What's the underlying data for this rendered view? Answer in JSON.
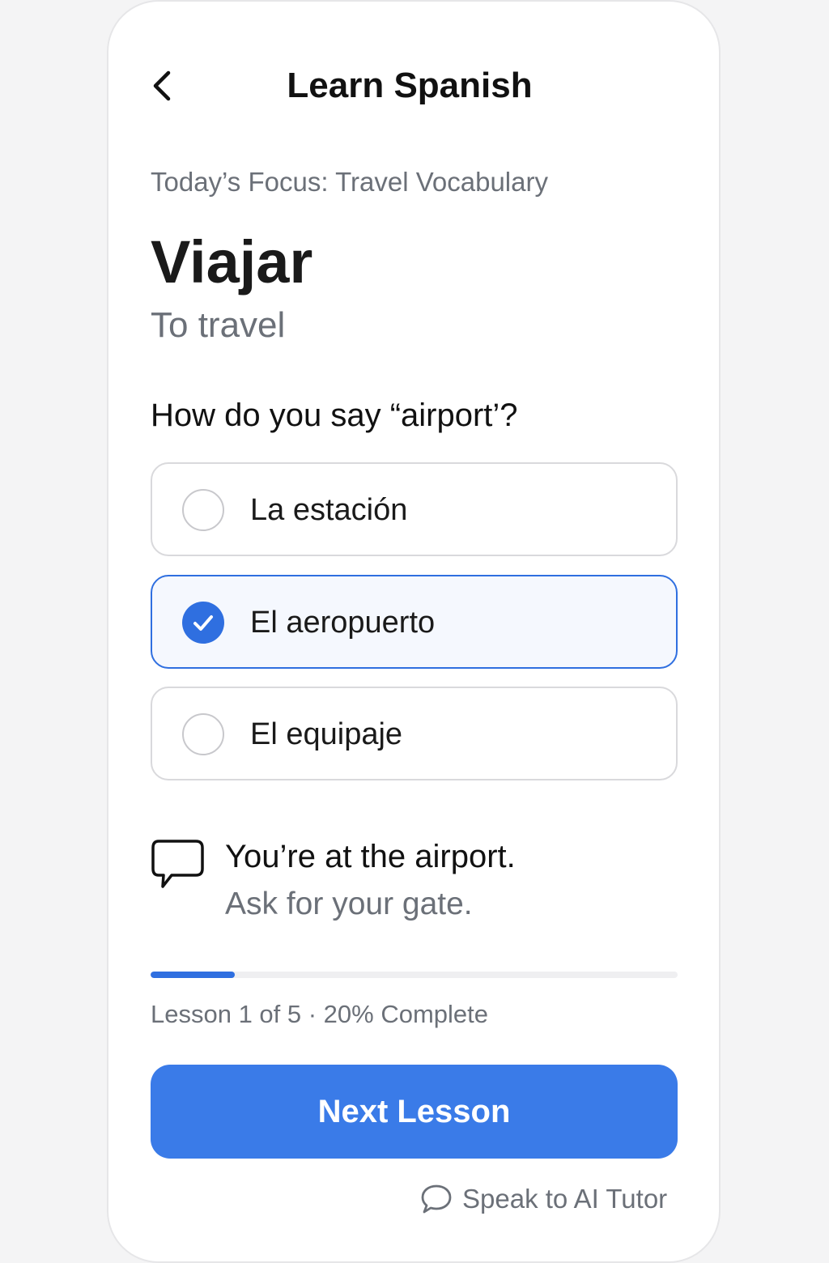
{
  "header": {
    "title": "Learn Spanish",
    "back_icon": "chevron-left-icon"
  },
  "lesson": {
    "focus": "Today’s Focus: Travel Vocabulary",
    "word": "Viajar",
    "translation": "To travel"
  },
  "quiz": {
    "question": "How do you say “airport’?",
    "options": [
      {
        "label": "La estación",
        "selected": false
      },
      {
        "label": "El aeropuerto",
        "selected": true
      },
      {
        "label": "El equipaje",
        "selected": false
      }
    ]
  },
  "scenario": {
    "icon": "speech-bubble-icon",
    "line1": "You’re at the airport.",
    "line2": "Ask for your gate."
  },
  "progress": {
    "fraction": 0.16,
    "text": "Lesson 1 of 5 · 20% Complete"
  },
  "actions": {
    "next_label": "Next Lesson",
    "tutor_label": "Speak to AI Tutor",
    "tutor_icon": "chat-bubble-icon"
  },
  "colors": {
    "accent": "#2f6fe0",
    "button": "#3a7be8",
    "muted_text": "#6b7078"
  }
}
